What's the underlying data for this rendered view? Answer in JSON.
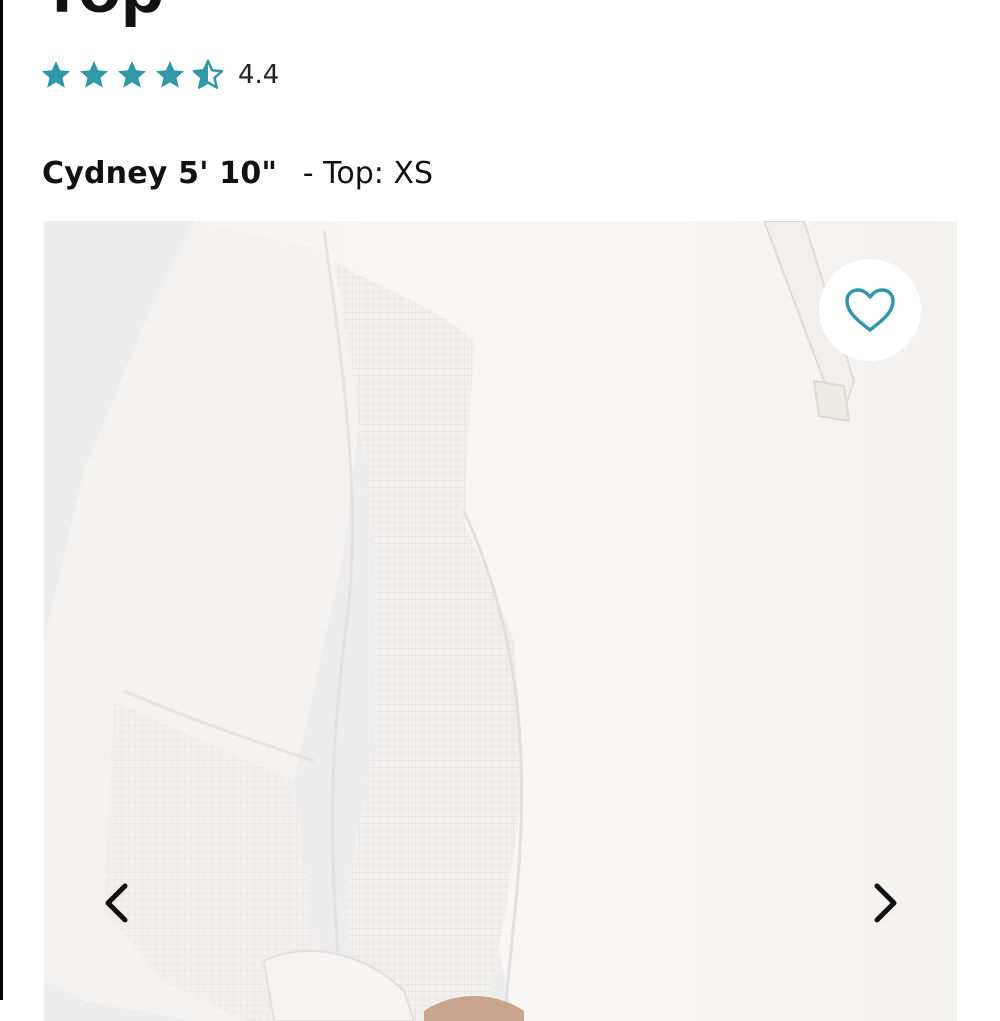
{
  "product": {
    "title": "Top",
    "rating_value": "4.4",
    "rating": 4.4,
    "rating_max": 5,
    "model_name": "Cydney 5' 10\"",
    "model_size": "- Top: XS"
  },
  "colors": {
    "accent": "#2f97a8",
    "text": "#111111",
    "arrow": "#111111"
  },
  "icons": {
    "star_full": "star-icon",
    "star_half": "half-star-icon",
    "favorite": "heart-icon",
    "prev": "chevron-left-icon",
    "next": "chevron-right-icon"
  }
}
